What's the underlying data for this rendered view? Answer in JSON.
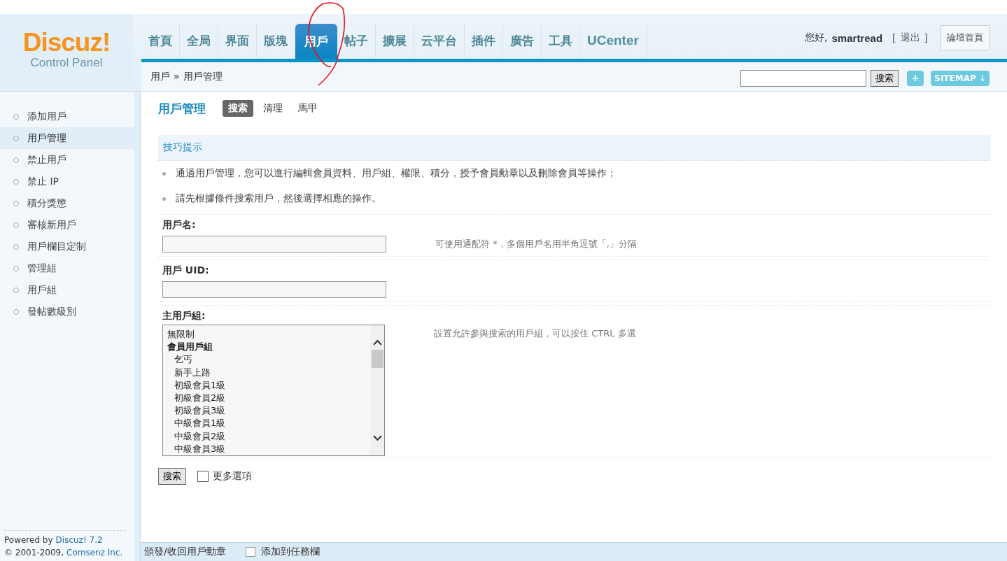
{
  "logo": {
    "title": "Discuz!",
    "subtitle": "Control Panel"
  },
  "nav": [
    {
      "label": "首頁",
      "selected": false
    },
    {
      "label": "全局",
      "selected": false
    },
    {
      "label": "界面",
      "selected": false
    },
    {
      "label": "版塊",
      "selected": false
    },
    {
      "label": "用戶",
      "selected": true
    },
    {
      "label": "帖子",
      "selected": false
    },
    {
      "label": "擴展",
      "selected": false
    },
    {
      "label": "云平台",
      "selected": false
    },
    {
      "label": "插件",
      "selected": false
    },
    {
      "label": "廣告",
      "selected": false
    },
    {
      "label": "工具",
      "selected": false
    },
    {
      "label": "UCenter",
      "selected": false
    }
  ],
  "user": {
    "greeting": "您好,",
    "name": "smartread",
    "open_bracket": "[",
    "logout": "退出",
    "close_bracket": "]",
    "forum_home": "論壇首頁"
  },
  "breadcrumb": {
    "section": "用戶",
    "separator": "»",
    "page": "用戶管理"
  },
  "top_search": {
    "button": "搜索"
  },
  "top_buttons": {
    "add": "+",
    "sitemap": "SITEMAP ↓"
  },
  "sidebar": {
    "items": [
      {
        "label": "添加用戶",
        "selected": false
      },
      {
        "label": "用戶管理",
        "selected": true
      },
      {
        "label": "禁止用戶",
        "selected": false
      },
      {
        "label": "禁止 IP",
        "selected": false
      },
      {
        "label": "積分獎懲",
        "selected": false
      },
      {
        "label": "審核新用戶",
        "selected": false
      },
      {
        "label": "用戶欄目定制",
        "selected": false
      },
      {
        "label": "管理組",
        "selected": false
      },
      {
        "label": "用戶組",
        "selected": false
      },
      {
        "label": "發帖數級別",
        "selected": false
      }
    ],
    "powered_by": "Powered by",
    "product": "Discuz! 7.2",
    "copyright": "© 2001-2009,",
    "company": "Comsenz Inc."
  },
  "page": {
    "title": "用戶管理",
    "tabs": [
      {
        "label": "搜索",
        "selected": true
      },
      {
        "label": "清理",
        "selected": false
      },
      {
        "label": "馬甲",
        "selected": false
      }
    ]
  },
  "tips": {
    "title": "技巧提示",
    "items": [
      "通過用戶管理，您可以進行編輯會員資料、用戶組、權限、積分，授予會員勳章以及刪除會員等操作；",
      "請先根據條件搜索用戶，然後選擇相應的操作。"
    ]
  },
  "form": {
    "fields": [
      {
        "kind": "text",
        "label": "用戶名:",
        "hint": "可使用通配符 *，多個用戶名用半角逗號「,」分隔"
      },
      {
        "kind": "text",
        "label": "用戶 UID:"
      },
      {
        "kind": "list",
        "label": "主用戶組:",
        "hint": "設置允許參與搜索的用戶組，可以按住 CTRL 多選",
        "options": [
          {
            "kind": "option",
            "label": "無限制"
          },
          {
            "kind": "group",
            "label": "會員用戶組"
          },
          {
            "kind": "option",
            "label": "乞丐"
          },
          {
            "kind": "option",
            "label": "新手上路"
          },
          {
            "kind": "option",
            "label": "初級會員1級"
          },
          {
            "kind": "option",
            "label": "初級會員2級"
          },
          {
            "kind": "option",
            "label": "初級會員3級"
          },
          {
            "kind": "option",
            "label": "中級會員1級"
          },
          {
            "kind": "option",
            "label": "中級會員2級"
          },
          {
            "kind": "option",
            "label": "中級會員3級"
          }
        ]
      }
    ],
    "submit": "搜索",
    "more_options": {
      "label": "更多選項",
      "checked": false
    }
  },
  "bottom_bar": {
    "items": [
      "頒發/收回用戶勳章",
      "添加到任務欄"
    ]
  }
}
